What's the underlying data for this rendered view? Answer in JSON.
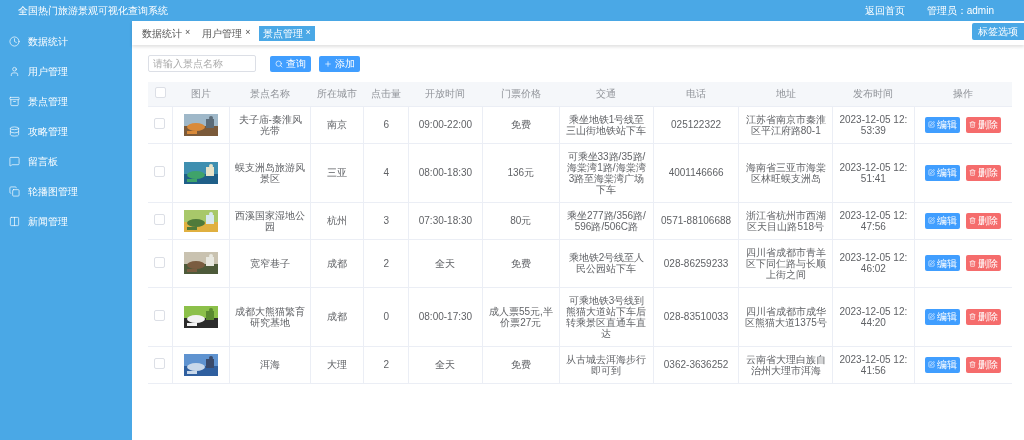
{
  "header": {
    "title": "全国热门旅游景观可视化查询系统",
    "links": [
      "返回首页",
      "管理员：admin"
    ]
  },
  "sidebar": {
    "items": [
      {
        "label": "数据统计"
      },
      {
        "label": "用户管理"
      },
      {
        "label": "景点管理"
      },
      {
        "label": "攻略管理"
      },
      {
        "label": "留言板"
      },
      {
        "label": "轮播图管理"
      },
      {
        "label": "新闻管理"
      }
    ]
  },
  "tabs": [
    {
      "label": "数据统计",
      "close": "×",
      "selected": false
    },
    {
      "label": "用户管理",
      "close": "×",
      "selected": false
    },
    {
      "label": "景点管理",
      "close": "×",
      "selected": true
    }
  ],
  "tab_options": "标签选项",
  "search": {
    "placeholder": "请输入景点名称"
  },
  "buttons": [
    {
      "label": "查询"
    },
    {
      "label": "添加"
    }
  ],
  "table": {
    "header_checkbox": {
      "checked": false
    },
    "columns": [
      "图片",
      "景点名称",
      "所在城市",
      "点击量",
      "开放时间",
      "门票价格",
      "交通",
      "电话",
      "地址",
      "发布时间",
      "操作"
    ],
    "rows": [
      {
        "checked": false,
        "image": {
          "kind": "picture"
        },
        "name": "夫子庙-秦淮风光带",
        "city": "南京",
        "clicks": "6",
        "hours": "09:00-22:00",
        "price": "免费",
        "transport": "乘坐地铁1号线至三山街地铁站下车",
        "phone": "025122322",
        "address": "江苏省南京市秦淮区平江府路80-1",
        "published": "2023-12-05 12:53:39",
        "actions": [
          {
            "label": "编辑",
            "kind": "edit"
          },
          {
            "label": "删除",
            "kind": "delete"
          }
        ]
      },
      {
        "checked": false,
        "image": {
          "kind": "picture"
        },
        "name": "蜈支洲岛旅游风景区",
        "city": "三亚",
        "clicks": "4",
        "hours": "08:00-18:30",
        "price": "136元",
        "transport": "可乘坐33路/35路/海棠湾1路/海棠湾3路至海棠湾广场下车",
        "phone": "4001146666",
        "address": "海南省三亚市海棠区林旺蜈支洲岛",
        "published": "2023-12-05 12:51:41",
        "actions": [
          {
            "label": "编辑",
            "kind": "edit"
          },
          {
            "label": "删除",
            "kind": "delete"
          }
        ]
      },
      {
        "checked": false,
        "image": {
          "kind": "picture"
        },
        "name": "西溪国家湿地公园",
        "city": "杭州",
        "clicks": "3",
        "hours": "07:30-18:30",
        "price": "80元",
        "transport": "乘坐277路/356路/596路/506C路",
        "phone": "0571-88106688",
        "address": "浙江省杭州市西湖区天目山路518号",
        "published": "2023-12-05 12:47:56",
        "actions": [
          {
            "label": "编辑",
            "kind": "edit"
          },
          {
            "label": "删除",
            "kind": "delete"
          }
        ]
      },
      {
        "checked": false,
        "image": {
          "kind": "picture"
        },
        "name": "宽窄巷子",
        "city": "成都",
        "clicks": "2",
        "hours": "全天",
        "price": "免费",
        "transport": "乘地铁2号线至人民公园站下车",
        "phone": "028-86259233",
        "address": "四川省成都市青羊区下同仁路与长顺上街之间",
        "published": "2023-12-05 12:46:02",
        "actions": [
          {
            "label": "编辑",
            "kind": "edit"
          },
          {
            "label": "删除",
            "kind": "delete"
          }
        ]
      },
      {
        "checked": false,
        "image": {
          "kind": "picture"
        },
        "name": "成都大熊猫繁育研究基地",
        "city": "成都",
        "clicks": "0",
        "hours": "08:00-17:30",
        "price": "成人票55元,半价票27元",
        "transport": "可乘地铁3号线到熊猫大道站下车后转乘景区直通车直达",
        "phone": "028-83510033",
        "address": "四川省成都市成华区熊猫大道1375号",
        "published": "2023-12-05 12:44:20",
        "actions": [
          {
            "label": "编辑",
            "kind": "edit"
          },
          {
            "label": "删除",
            "kind": "delete"
          }
        ]
      },
      {
        "checked": false,
        "image": {
          "kind": "picture"
        },
        "name": "洱海",
        "city": "大理",
        "clicks": "2",
        "hours": "全天",
        "price": "免费",
        "transport": "从古城去洱海步行即可到",
        "phone": "0362-3636252",
        "address": "云南省大理白族自治州大理市洱海",
        "published": "2023-12-05 12:41:56",
        "actions": [
          {
            "label": "编辑",
            "kind": "edit"
          },
          {
            "label": "删除",
            "kind": "delete"
          }
        ]
      }
    ]
  }
}
